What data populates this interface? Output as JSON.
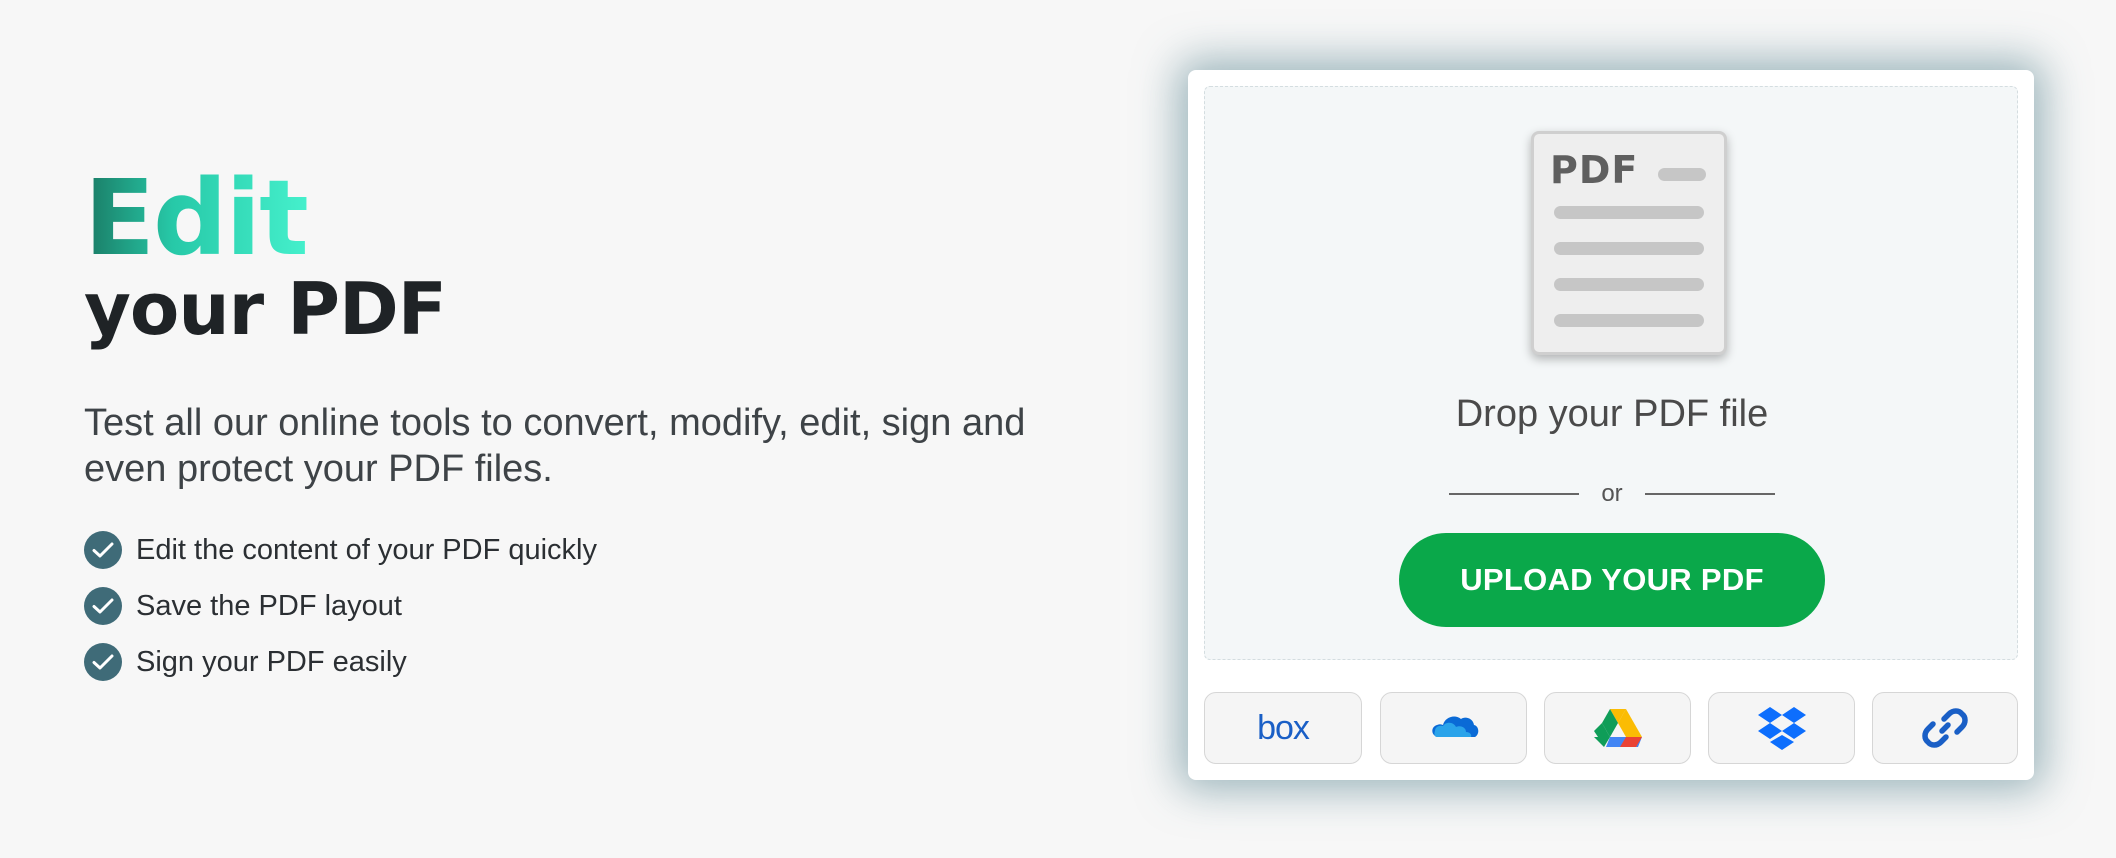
{
  "hero": {
    "title_accent": "Edit",
    "title_main": "your PDF",
    "description": "Test all our online tools to convert, modify, edit, sign and even protect your PDF files.",
    "features": [
      {
        "label": "Edit the content of your PDF quickly",
        "icon": "check-circle-icon"
      },
      {
        "label": "Save the PDF layout",
        "icon": "check-circle-icon"
      },
      {
        "label": "Sign your PDF easily",
        "icon": "check-circle-icon"
      }
    ]
  },
  "upload": {
    "doc_label": "PDF",
    "drop_text": "Drop your PDF file",
    "or_text": "or",
    "button_label": "UPLOAD YOUR PDF",
    "sources": [
      {
        "name": "box",
        "icon": "box-icon",
        "text": "box"
      },
      {
        "name": "onedrive",
        "icon": "onedrive-icon"
      },
      {
        "name": "google-drive",
        "icon": "google-drive-icon"
      },
      {
        "name": "dropbox",
        "icon": "dropbox-icon"
      },
      {
        "name": "url",
        "icon": "link-icon"
      }
    ]
  },
  "colors": {
    "accent_gradient": [
      "#1a7a64",
      "#45f0cc"
    ],
    "check": "#3f6b78",
    "upload_button": "#0aa84a",
    "card_shadow": "#507d8a"
  }
}
